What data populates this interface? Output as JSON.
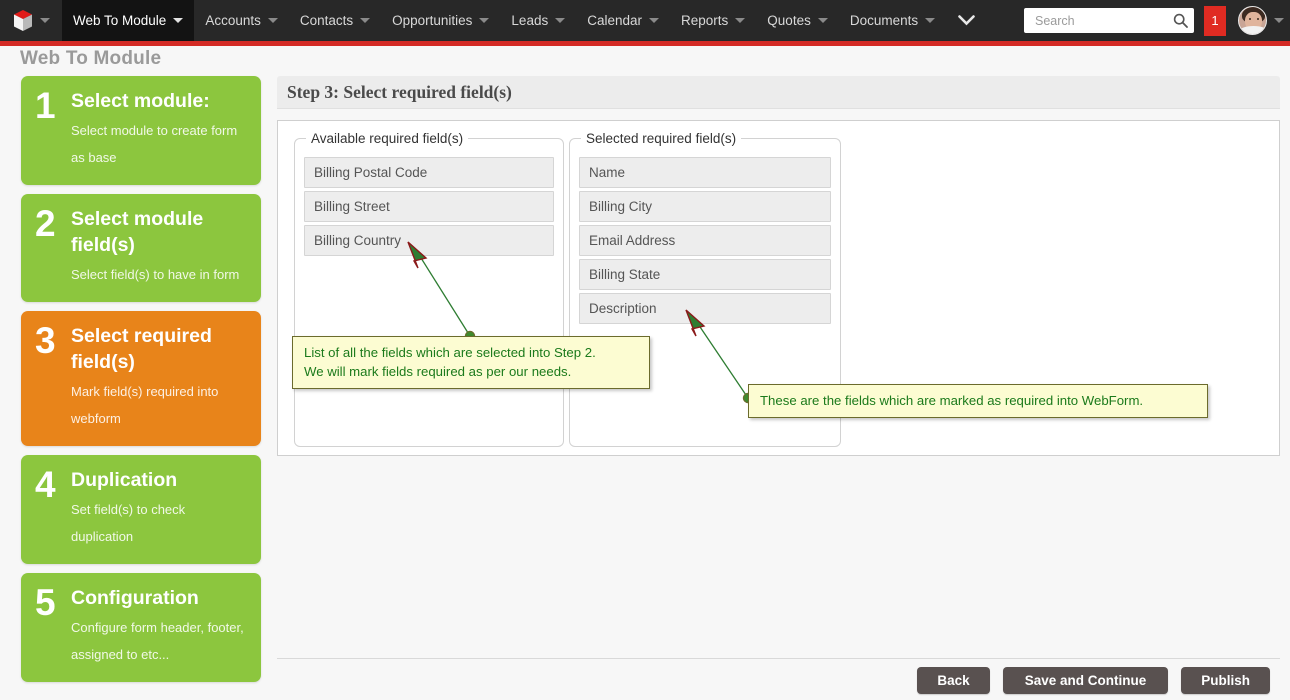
{
  "navbar": {
    "logo_icon": "cube-logo-icon",
    "logo_caret_icon": "chevron-down-icon",
    "items": [
      {
        "label": "Web To Module",
        "active": true
      },
      {
        "label": "Accounts",
        "active": false
      },
      {
        "label": "Contacts",
        "active": false
      },
      {
        "label": "Opportunities",
        "active": false
      },
      {
        "label": "Leads",
        "active": false
      },
      {
        "label": "Calendar",
        "active": false
      },
      {
        "label": "Reports",
        "active": false
      },
      {
        "label": "Quotes",
        "active": false
      },
      {
        "label": "Documents",
        "active": false
      }
    ],
    "overflow_icon": "chevron-down-icon",
    "search": {
      "value": "",
      "placeholder": "Search",
      "icon": "search-icon"
    },
    "notification_badge": "1",
    "avatar_icon": "user-avatar",
    "avatar_caret_icon": "chevron-down-icon",
    "colors": {
      "bar": "#282828",
      "active_tab": "#131313",
      "accent_red": "#d42b25",
      "badge": "#e02b22"
    }
  },
  "page": {
    "title": "Web To Module"
  },
  "sidebar": {
    "items": [
      {
        "num": "1",
        "title": "Select module:",
        "desc": "Select module to create form as base",
        "state": "done",
        "color": "#8cc63e"
      },
      {
        "num": "2",
        "title": "Select module field(s)",
        "desc": "Select field(s) to have in form",
        "state": "done",
        "color": "#8cc63e"
      },
      {
        "num": "3",
        "title": "Select required field(s)",
        "desc": "Mark field(s) required into webform",
        "state": "active",
        "color": "#e8841a"
      },
      {
        "num": "4",
        "title": "Duplication",
        "desc": "Set field(s) to check duplication",
        "state": "pending",
        "color": "#8cc63e"
      },
      {
        "num": "5",
        "title": "Configuration",
        "desc": "Configure form header, footer, assigned to etc...",
        "state": "pending",
        "color": "#8cc63e"
      }
    ]
  },
  "main": {
    "step_header": "Step 3: Select required field(s)",
    "available": {
      "legend": "Available required field(s)",
      "items": [
        "Billing Postal Code",
        "Billing Street",
        "Billing Country"
      ]
    },
    "selected": {
      "legend": "Selected required field(s)",
      "items": [
        "Name",
        "Billing City",
        "Email Address",
        "Billing State",
        "Description"
      ]
    }
  },
  "footer": {
    "back_label": "Back",
    "save_label": "Save and Continue",
    "publish_label": "Publish"
  },
  "annotations": [
    {
      "id": "callout-1",
      "line1": "List of all the fields which are selected into Step 2.",
      "line2": "We will mark fields required as per our needs."
    },
    {
      "id": "callout-2",
      "line1": "These are the fields which are marked as required into WebForm.",
      "line2": ""
    }
  ],
  "annotation_style": {
    "fill": "#fcfcd2",
    "border": "#6b6b2c",
    "text": "#1b7a1b",
    "arrow": "#2e7d32",
    "arrow_outline": "#8b1a1a"
  }
}
